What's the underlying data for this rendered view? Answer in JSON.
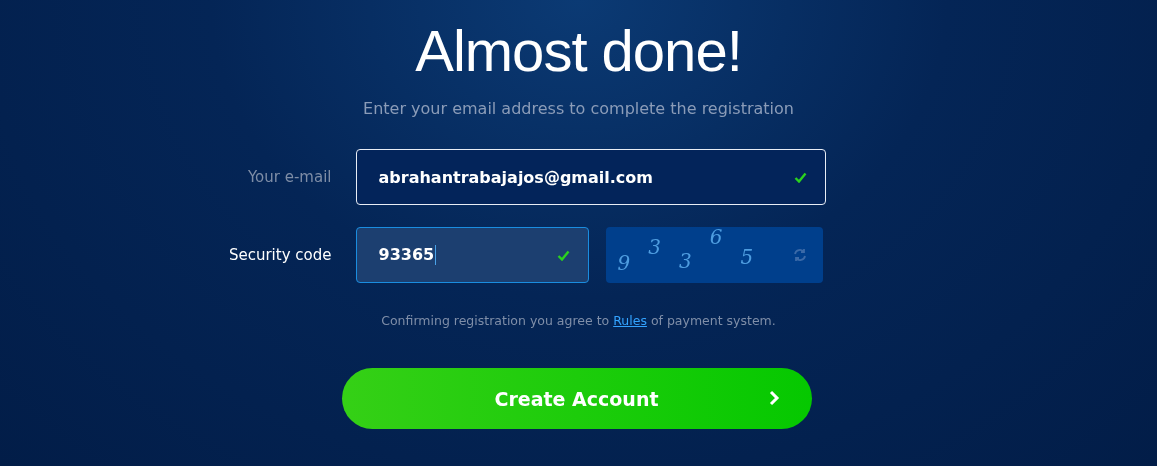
{
  "title": "Almost done!",
  "subtitle": "Enter your email address to complete the registration",
  "fields": [
    {
      "label": "Your e-mail",
      "value": "abrahantrabajajos@gmail.com",
      "valid": true,
      "focused": false
    },
    {
      "label": "Security code",
      "value": "93365",
      "valid": true,
      "focused": true
    }
  ],
  "captcha": {
    "characters": [
      "9",
      "3",
      "3",
      "6",
      "5"
    ]
  },
  "terms": {
    "before": "Confirming registration you agree to",
    "link": "Rules",
    "after": "of payment system."
  },
  "submit": {
    "label": "Create Account"
  }
}
